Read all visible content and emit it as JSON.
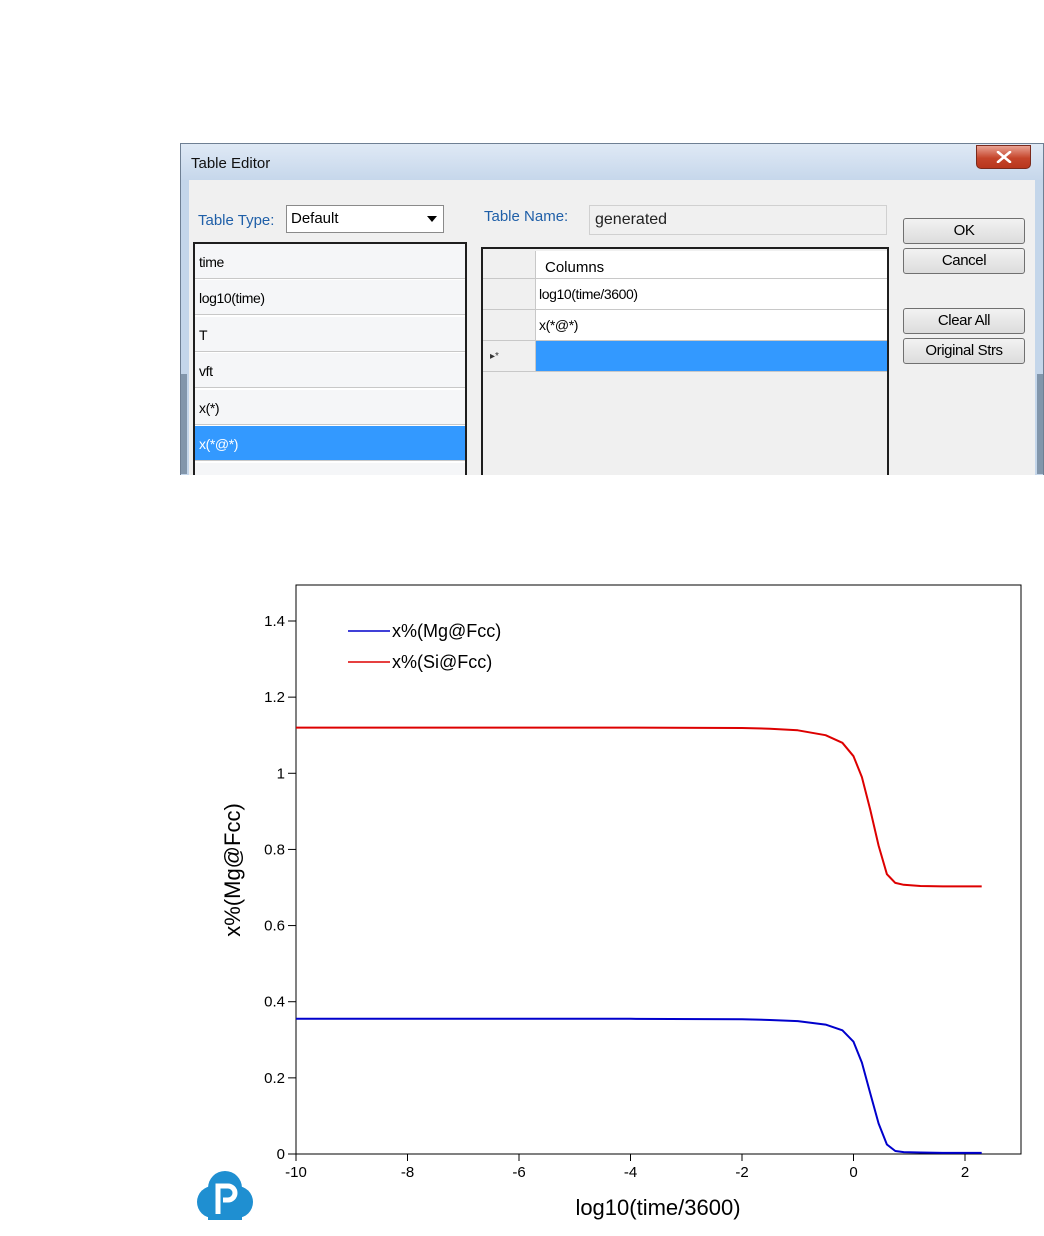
{
  "dialog": {
    "title": "Table Editor",
    "table_type_label": "Table Type:",
    "table_type_value": "Default",
    "table_name_label": "Table Name:",
    "table_name_value": "generated",
    "left_list": [
      {
        "label": "time",
        "selected": false
      },
      {
        "label": "log10(time)",
        "selected": false
      },
      {
        "label": "T",
        "selected": false
      },
      {
        "label": "vft",
        "selected": false
      },
      {
        "label": "x(*)",
        "selected": false
      },
      {
        "label": "x(*@*)",
        "selected": true
      }
    ],
    "grid": {
      "header": "Columns",
      "rows": [
        "log10(time/3600)",
        "x(*@*)"
      ],
      "new_row_marker": "▸*"
    },
    "buttons": {
      "ok": "OK",
      "cancel": "Cancel",
      "clear_all": "Clear All",
      "original_strs": "Original Strs"
    }
  },
  "chart_data": {
    "type": "line",
    "xlabel": "log10(time/3600)",
    "ylabel": "x%(Mg@Fcc)",
    "xlim": [
      -10,
      3
    ],
    "ylim": [
      0,
      1.5
    ],
    "xticks": [
      -10,
      -8,
      -6,
      -4,
      -2,
      0,
      2
    ],
    "xtick_labels": [
      "-10",
      "-8",
      "-6",
      "-4",
      "-2",
      "0",
      "2"
    ],
    "yticks": [
      0,
      0.2,
      0.4,
      0.6,
      0.8,
      1,
      1.2,
      1.4
    ],
    "ytick_labels": [
      "0",
      "0.2",
      "0.4",
      "0.6",
      "0.8",
      "1",
      "1.2",
      "1.4"
    ],
    "grid": false,
    "legend_position": "top-left",
    "series": [
      {
        "name": "x%(Mg@Fcc)",
        "color": "#0000cc",
        "x": [
          -10,
          -6,
          -4,
          -2,
          -1.5,
          -1,
          -0.5,
          -0.2,
          0,
          0.15,
          0.3,
          0.45,
          0.6,
          0.75,
          0.9,
          1.2,
          1.6,
          2.3
        ],
        "y": [
          0.355,
          0.355,
          0.355,
          0.354,
          0.352,
          0.349,
          0.34,
          0.325,
          0.295,
          0.24,
          0.16,
          0.08,
          0.025,
          0.008,
          0.005,
          0.004,
          0.003,
          0.003
        ]
      },
      {
        "name": "x%(Si@Fcc)",
        "color": "#dd0000",
        "x": [
          -10,
          -6,
          -4,
          -2,
          -1.5,
          -1,
          -0.5,
          -0.2,
          0,
          0.15,
          0.3,
          0.45,
          0.6,
          0.75,
          0.9,
          1.2,
          1.6,
          2.3
        ],
        "y": [
          1.12,
          1.12,
          1.12,
          1.119,
          1.117,
          1.113,
          1.1,
          1.08,
          1.045,
          0.99,
          0.905,
          0.81,
          0.735,
          0.712,
          0.707,
          0.704,
          0.703,
          0.703
        ]
      }
    ]
  }
}
